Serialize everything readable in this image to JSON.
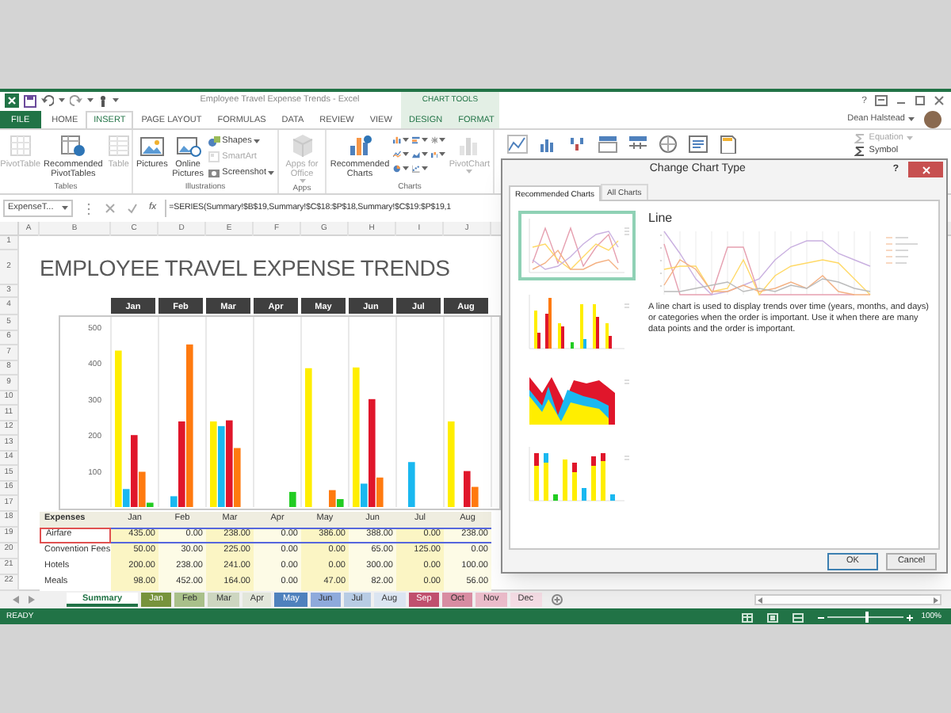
{
  "title_bar": {
    "title": "Employee Travel Expense Trends - Excel",
    "context_label": "CHART TOOLS",
    "help": "?"
  },
  "ribbon_tabs": [
    {
      "label": "FILE",
      "kind": "file",
      "selected": false
    },
    {
      "label": "HOME",
      "kind": "main",
      "selected": false
    },
    {
      "label": "INSERT",
      "kind": "main",
      "selected": true
    },
    {
      "label": "PAGE LAYOUT",
      "kind": "main",
      "selected": false
    },
    {
      "label": "FORMULAS",
      "kind": "main",
      "selected": false
    },
    {
      "label": "DATA",
      "kind": "main",
      "selected": false
    },
    {
      "label": "REVIEW",
      "kind": "main",
      "selected": false
    },
    {
      "label": "VIEW",
      "kind": "main",
      "selected": false
    },
    {
      "label": "DESIGN",
      "kind": "context",
      "selected": false
    },
    {
      "label": "FORMAT",
      "kind": "context",
      "selected": false
    }
  ],
  "account": {
    "name": "Dean Halstead"
  },
  "ribbon_groups": [
    {
      "label": "Tables",
      "commands": [
        {
          "label": "PivotTable",
          "kind": "large",
          "disabled": true
        },
        {
          "label": "Recommended PivotTables",
          "kind": "large",
          "disabled": false
        },
        {
          "label": "Table",
          "kind": "large",
          "disabled": true
        }
      ]
    },
    {
      "label": "Illustrations",
      "commands": [
        {
          "label": "Pictures",
          "kind": "large",
          "disabled": false
        },
        {
          "label": "Online Pictures",
          "kind": "large",
          "disabled": false
        },
        {
          "label": "Shapes",
          "kind": "small",
          "disabled": false,
          "dropdown": true
        },
        {
          "label": "SmartArt",
          "kind": "small",
          "disabled": true
        },
        {
          "label": "Screenshot",
          "kind": "small",
          "disabled": false,
          "dropdown": true
        }
      ]
    },
    {
      "label": "Apps",
      "commands": [
        {
          "label": "Apps for Office",
          "kind": "large",
          "disabled": true,
          "dropdown": true
        }
      ]
    },
    {
      "label": "Charts",
      "commands": [
        {
          "label": "Recommended Charts",
          "kind": "large",
          "disabled": false
        },
        {
          "kind": "icons"
        },
        {
          "label": "PivotChart",
          "kind": "large",
          "disabled": true,
          "dropdown": true
        }
      ]
    }
  ],
  "ribbon_extra": [
    {
      "label": "Equation",
      "disabled": true,
      "dropdown": true
    },
    {
      "label": "Symbol",
      "disabled": false
    }
  ],
  "formula_bar": {
    "name_box": "ExpenseT...",
    "function_button": "fx",
    "formula": "=SERIES(Summary!$B$19,Summary!$C$18:$P$18,Summary!$C$19:$P$19,1"
  },
  "sheet": {
    "column_headers": [
      "A",
      "B",
      "C",
      "D",
      "E",
      "F",
      "G",
      "H",
      "I",
      "J"
    ],
    "row_numbers": [
      "1",
      "2",
      "3",
      "4",
      "5",
      "6",
      "7",
      "8",
      "9",
      "10",
      "11",
      "12",
      "13",
      "14",
      "15",
      "16",
      "17",
      "18",
      "19",
      "20",
      "21",
      "22"
    ],
    "title": "EMPLOYEE TRAVEL EXPENSE TRENDS",
    "chart_data": {
      "type": "bar",
      "categories": [
        "Jan",
        "Feb",
        "Mar",
        "Apr",
        "May",
        "Jun",
        "Jul",
        "Aug"
      ],
      "series": [
        {
          "color": "#ffee00",
          "values": [
            435,
            0,
            238,
            0,
            386,
            388,
            0,
            238
          ]
        },
        {
          "color": "#1ab8f0",
          "values": [
            50,
            30,
            225,
            0,
            0,
            65,
            125,
            0
          ]
        },
        {
          "color": "#e0162b",
          "values": [
            200,
            238,
            241,
            0,
            0,
            300,
            0,
            100
          ]
        },
        {
          "color": "#ff7a0f",
          "values": [
            98,
            452,
            164,
            0,
            47,
            82,
            0,
            56
          ]
        },
        {
          "color": "#22cc22",
          "values": [
            12,
            0,
            0,
            42,
            22,
            0,
            0,
            0
          ]
        }
      ],
      "ylim": [
        0,
        500
      ],
      "yticks": [
        {
          "value": 100,
          "label": "100"
        },
        {
          "value": 200,
          "label": "200"
        },
        {
          "value": 300,
          "label": "300"
        },
        {
          "value": 400,
          "label": "400"
        },
        {
          "value": 500,
          "label": "500"
        }
      ]
    },
    "table": {
      "header": [
        "Expenses",
        "Jan",
        "Feb",
        "Mar",
        "Apr",
        "May",
        "Jun",
        "Jul",
        "Aug"
      ],
      "rows": [
        {
          "selected": true,
          "cells": [
            "Airfare",
            "435.00",
            "0.00",
            "238.00",
            "0.00",
            "386.00",
            "388.00",
            "0.00",
            "238.00"
          ]
        },
        {
          "selected": false,
          "cells": [
            "Convention Fees",
            "50.00",
            "30.00",
            "225.00",
            "0.00",
            "0.00",
            "65.00",
            "125.00",
            "0.00"
          ]
        },
        {
          "selected": false,
          "cells": [
            "Hotels",
            "200.00",
            "238.00",
            "241.00",
            "0.00",
            "0.00",
            "300.00",
            "0.00",
            "100.00"
          ]
        },
        {
          "selected": false,
          "cells": [
            "Meals",
            "98.00",
            "452.00",
            "164.00",
            "0.00",
            "47.00",
            "82.00",
            "0.00",
            "56.00"
          ]
        }
      ]
    }
  },
  "sheet_tabs": [
    {
      "label": "Summary",
      "selected": true
    },
    {
      "label": "Jan",
      "selected": false,
      "color": "#77933c"
    },
    {
      "label": "Feb",
      "selected": false,
      "color": "#a9c08a"
    },
    {
      "label": "Mar",
      "selected": false,
      "color": "#cdd6c0"
    },
    {
      "label": "Apr",
      "selected": false,
      "color": "#e2e6da"
    },
    {
      "label": "May",
      "selected": false,
      "color": "#4f81bd"
    },
    {
      "label": "Jun",
      "selected": false,
      "color": "#8eaadb"
    },
    {
      "label": "Jul",
      "selected": false,
      "color": "#b8cce4"
    },
    {
      "label": "Aug",
      "selected": false,
      "color": "#dbe5f1"
    },
    {
      "label": "Sep",
      "selected": false,
      "color": "#c0506e"
    },
    {
      "label": "Oct",
      "selected": false,
      "color": "#d88ca2"
    },
    {
      "label": "Nov",
      "selected": false,
      "color": "#ebbcca"
    },
    {
      "label": "Dec",
      "selected": false,
      "color": "#f5dde5"
    }
  ],
  "status_bar": {
    "status": "READY",
    "zoom_slider": {
      "level": 0.5
    },
    "zoom": "100%"
  },
  "dialog": {
    "title": "Change Chart Type",
    "help": "?",
    "tabs": [
      {
        "label": "Recommended Charts",
        "selected": true
      },
      {
        "label": "All Charts",
        "selected": false
      }
    ],
    "thumbnails": [
      {
        "kind": "line",
        "selected": true
      },
      {
        "kind": "column",
        "selected": false
      },
      {
        "kind": "area",
        "selected": false
      },
      {
        "kind": "stacked-column",
        "selected": false
      }
    ],
    "preview": {
      "heading": "Line",
      "description": "A line chart is used to display trends over time (years, months, and days) or categories when the order is important. Use it when there are many data points and the order is important."
    },
    "buttons": [
      {
        "label": "OK",
        "kind": "default"
      },
      {
        "label": "Cancel",
        "kind": "normal"
      }
    ]
  }
}
